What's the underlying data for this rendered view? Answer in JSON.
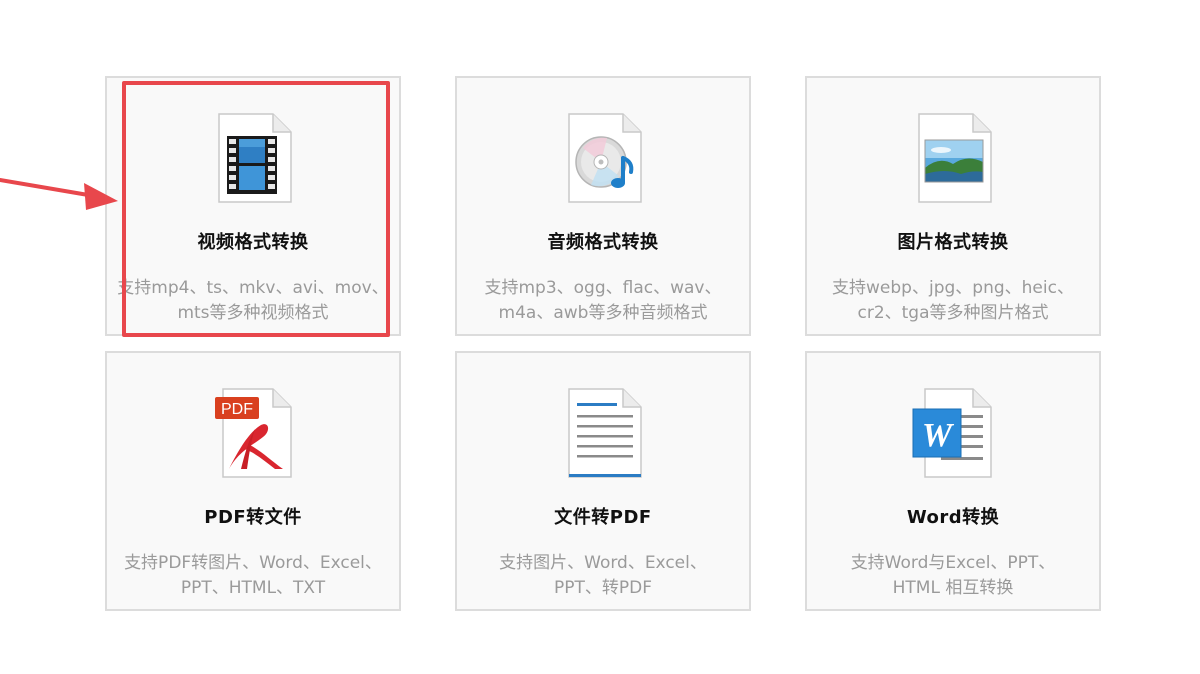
{
  "cards": [
    {
      "title": "视频格式转换",
      "desc_line1": "支持mp4、ts、mkv、avi、mov、",
      "desc_line2": "mts等多种视频格式",
      "icon": "video-file-icon"
    },
    {
      "title": "音频格式转换",
      "desc_line1": "支持mp3、ogg、flac、wav、",
      "desc_line2": "m4a、awb等多种音频格式",
      "icon": "audio-file-icon"
    },
    {
      "title": "图片格式转换",
      "desc_line1": "支持webp、jpg、png、heic、",
      "desc_line2": "cr2、tga等多种图片格式",
      "icon": "image-file-icon"
    },
    {
      "title": "PDF转文件",
      "desc_line1": "支持PDF转图片、Word、Excel、",
      "desc_line2": "PPT、HTML、TXT",
      "icon": "pdf-file-icon",
      "icon_badge": "PDF"
    },
    {
      "title": "文件转PDF",
      "desc_line1": "支持图片、Word、Excel、",
      "desc_line2": "PPT、转PDF",
      "icon": "document-file-icon"
    },
    {
      "title": "Word转换",
      "desc_line1": "支持Word与Excel、PPT、",
      "desc_line2": "HTML 相互转换",
      "icon": "word-file-icon",
      "icon_badge": "W"
    }
  ],
  "colors": {
    "highlight": "#e8474c",
    "card_border": "#dcdcdc",
    "card_background": "#f9f9f9",
    "title_text": "#111111",
    "desc_text": "#9a9a9a"
  }
}
